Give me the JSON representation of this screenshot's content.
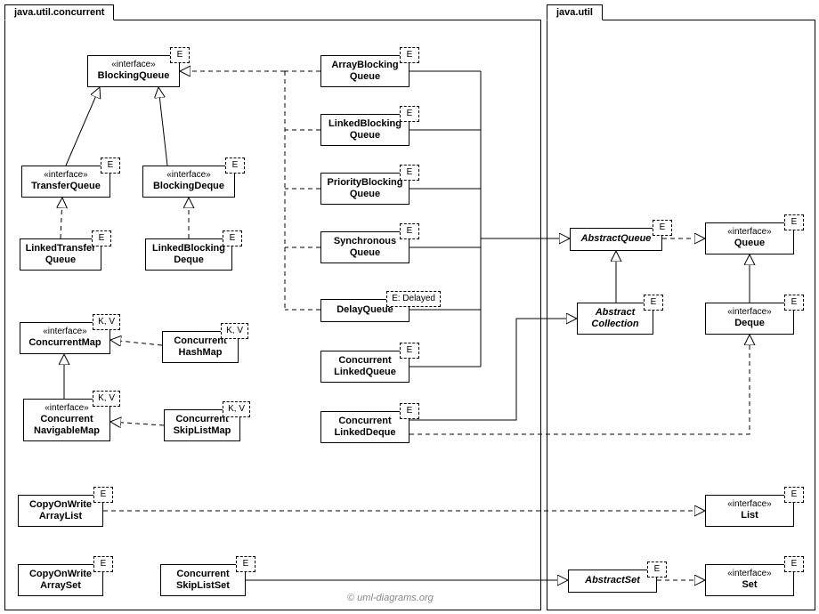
{
  "packages": {
    "concurrent": "java.util.concurrent",
    "util": "java.util"
  },
  "watermark": "© uml-diagrams.org",
  "badges": {
    "e": "E",
    "kv": "K, V",
    "edelayed": "E: Delayed"
  },
  "stereotype": {
    "interface": "«interface»"
  },
  "classes": {
    "BlockingQueue": "BlockingQueue",
    "TransferQueue": "TransferQueue",
    "BlockingDeque": "BlockingDeque",
    "LinkedTransferQueue_l1": "LinkedTransfer",
    "LinkedTransferQueue_l2": "Queue",
    "LinkedBlockingDeque_l1": "LinkedBlocking",
    "LinkedBlockingDeque_l2": "Deque",
    "ConcurrentMap": "ConcurrentMap",
    "ConcurrentHashMap_l1": "Concurrent",
    "ConcurrentHashMap_l2": "HashMap",
    "ConcurrentNavigableMap_l1": "Concurrent",
    "ConcurrentNavigableMap_l2": "NavigableMap",
    "ConcurrentSkipListMap_l1": "Concurrent",
    "ConcurrentSkipListMap_l2": "SkipListMap",
    "CopyOnWriteArrayList_l1": "CopyOnWrite",
    "CopyOnWriteArrayList_l2": "ArrayList",
    "CopyOnWriteArraySet_l1": "CopyOnWrite",
    "CopyOnWriteArraySet_l2": "ArraySet",
    "ConcurrentSkipListSet_l1": "Concurrent",
    "ConcurrentSkipListSet_l2": "SkipListSet",
    "ArrayBlockingQueue_l1": "ArrayBlocking",
    "ArrayBlockingQueue_l2": "Queue",
    "LinkedBlockingQueue_l1": "LinkedBlocking",
    "LinkedBlockingQueue_l2": "Queue",
    "PriorityBlockingQueue_l1": "PriorityBlocking",
    "PriorityBlockingQueue_l2": "Queue",
    "SynchronousQueue_l1": "Synchronous",
    "SynchronousQueue_l2": "Queue",
    "DelayQueue": "DelayQueue",
    "ConcurrentLinkedQueue_l1": "Concurrent",
    "ConcurrentLinkedQueue_l2": "LinkedQueue",
    "ConcurrentLinkedDeque_l1": "Concurrent",
    "ConcurrentLinkedDeque_l2": "LinkedDeque",
    "AbstractQueue": "AbstractQueue",
    "Queue": "Queue",
    "AbstractCollection_l1": "Abstract",
    "AbstractCollection_l2": "Collection",
    "Deque": "Deque",
    "List": "List",
    "AbstractSet": "AbstractSet",
    "Set": "Set"
  }
}
